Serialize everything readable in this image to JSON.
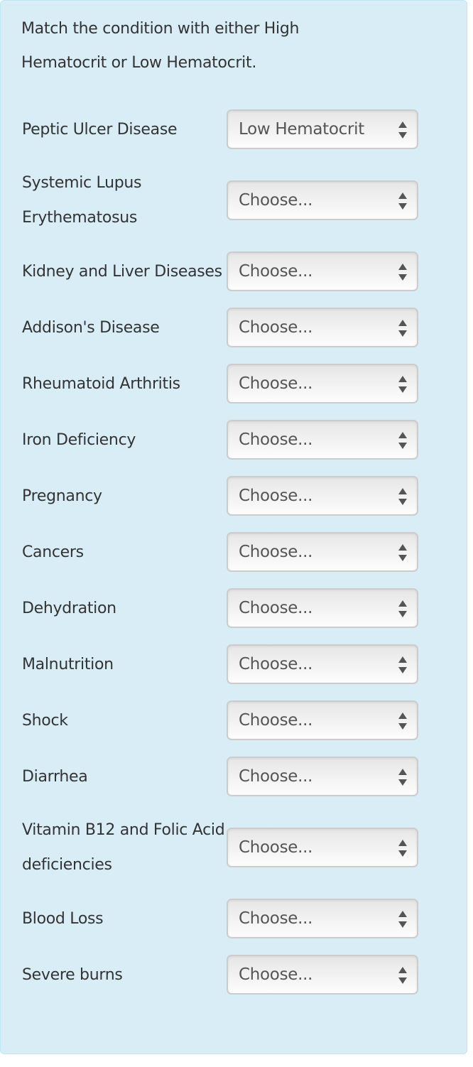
{
  "instructions": "Match the condition with either High Hematocrit or Low Hematocrit.",
  "items": [
    {
      "label": "Peptic Ulcer Disease",
      "selected": "Low Hematocrit"
    },
    {
      "label": "Systemic Lupus Erythematosus",
      "selected": "Choose..."
    },
    {
      "label": "Kidney and Liver Diseases",
      "selected": "Choose..."
    },
    {
      "label": "Addison's Disease",
      "selected": "Choose..."
    },
    {
      "label": "Rheumatoid Arthritis",
      "selected": "Choose..."
    },
    {
      "label": "Iron Deficiency",
      "selected": "Choose..."
    },
    {
      "label": "Pregnancy",
      "selected": "Choose..."
    },
    {
      "label": "Cancers",
      "selected": "Choose..."
    },
    {
      "label": "Dehydration",
      "selected": "Choose..."
    },
    {
      "label": "Malnutrition",
      "selected": "Choose..."
    },
    {
      "label": "Shock",
      "selected": "Choose..."
    },
    {
      "label": "Diarrhea",
      "selected": "Choose..."
    },
    {
      "label": "Vitamin B12 and Folic Acid deficiencies",
      "selected": "Choose..."
    },
    {
      "label": "Blood Loss",
      "selected": "Choose..."
    },
    {
      "label": "Severe burns",
      "selected": "Choose..."
    }
  ]
}
